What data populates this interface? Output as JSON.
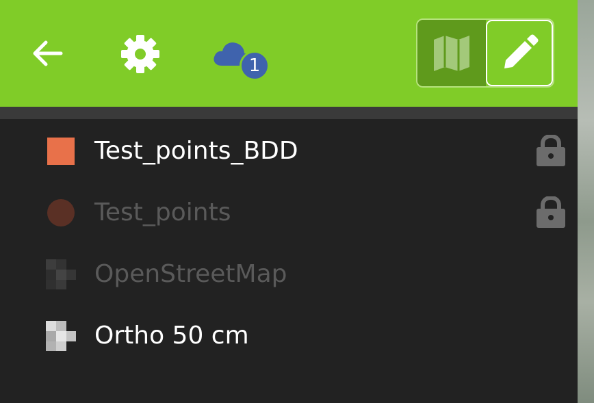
{
  "toolbar": {
    "back_icon": "arrow-left-icon",
    "settings_icon": "gear-icon",
    "sync_icon": "cloud-icon",
    "sync_badge": "1",
    "mode_map_icon": "map-icon",
    "mode_edit_icon": "pencil-icon",
    "bg_color": "#80cc28",
    "badge_color": "#3f63ad"
  },
  "layers": [
    {
      "label": "Test_points_BDD",
      "icon": "square-symbol-icon",
      "color": "#e8714a",
      "visible": true,
      "locked": true
    },
    {
      "label": "Test_points",
      "icon": "circle-symbol-icon",
      "color": "#5a3025",
      "visible": false,
      "locked": true
    },
    {
      "label": "OpenStreetMap",
      "icon": "raster-layer-icon",
      "visible": false,
      "locked": false
    },
    {
      "label": "Ortho 50 cm",
      "icon": "raster-layer-icon",
      "visible": true,
      "locked": false
    }
  ]
}
